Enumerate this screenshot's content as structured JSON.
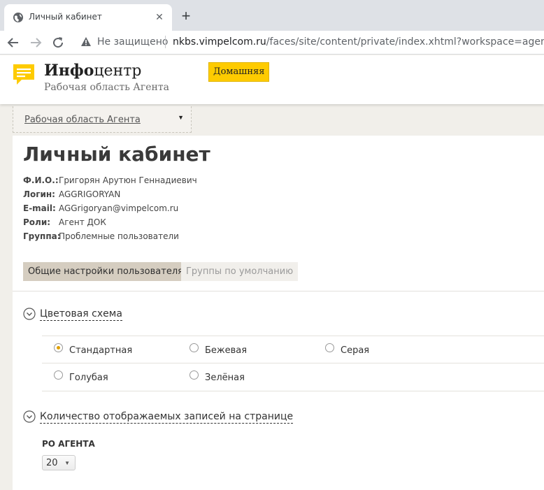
{
  "browser": {
    "tab_title": "Личный кабинет",
    "tab_close": "✕",
    "new_tab": "+",
    "not_secure": "Не защищено",
    "url_host": "nkbs.vimpelcom.ru",
    "url_path": "/faces/site/content/private/index.xhtml?workspace=agent"
  },
  "header": {
    "logo_bold": "Инфо",
    "logo_rest": "центр",
    "logo_subtitle": "Рабочая область Агента",
    "home_button": "Домашняя",
    "logo_color": "#fecb00"
  },
  "workspace": {
    "selected": "Рабочая область Агента"
  },
  "profile": {
    "title": "Личный кабинет",
    "fields": [
      {
        "label": "Ф.И.О.:",
        "value": "Григорян Арутюн Геннадиевич"
      },
      {
        "label": "Логин:",
        "value": "AGGRIGORYAN"
      },
      {
        "label": "E-mail:",
        "value": "AGGrigoryan@vimpelcom.ru"
      },
      {
        "label": "Роли:",
        "value": "Агент ДОК"
      },
      {
        "label": "Группа:",
        "value": "Проблемные пользователи"
      }
    ]
  },
  "tabs": [
    {
      "label": "Общие настройки пользователя",
      "active": true
    },
    {
      "label": "Группы по умолчанию",
      "active": false
    }
  ],
  "color_scheme": {
    "title": "Цветовая схема",
    "options": [
      {
        "label": "Стандартная",
        "checked": true
      },
      {
        "label": "Бежевая",
        "checked": false
      },
      {
        "label": "Серая",
        "checked": false
      },
      {
        "label": "Голубая",
        "checked": false
      },
      {
        "label": "Зелёная",
        "checked": false
      }
    ]
  },
  "records": {
    "title": "Количество отображаемых записей на странице",
    "label": "РО АГЕНТА",
    "value": "20"
  }
}
